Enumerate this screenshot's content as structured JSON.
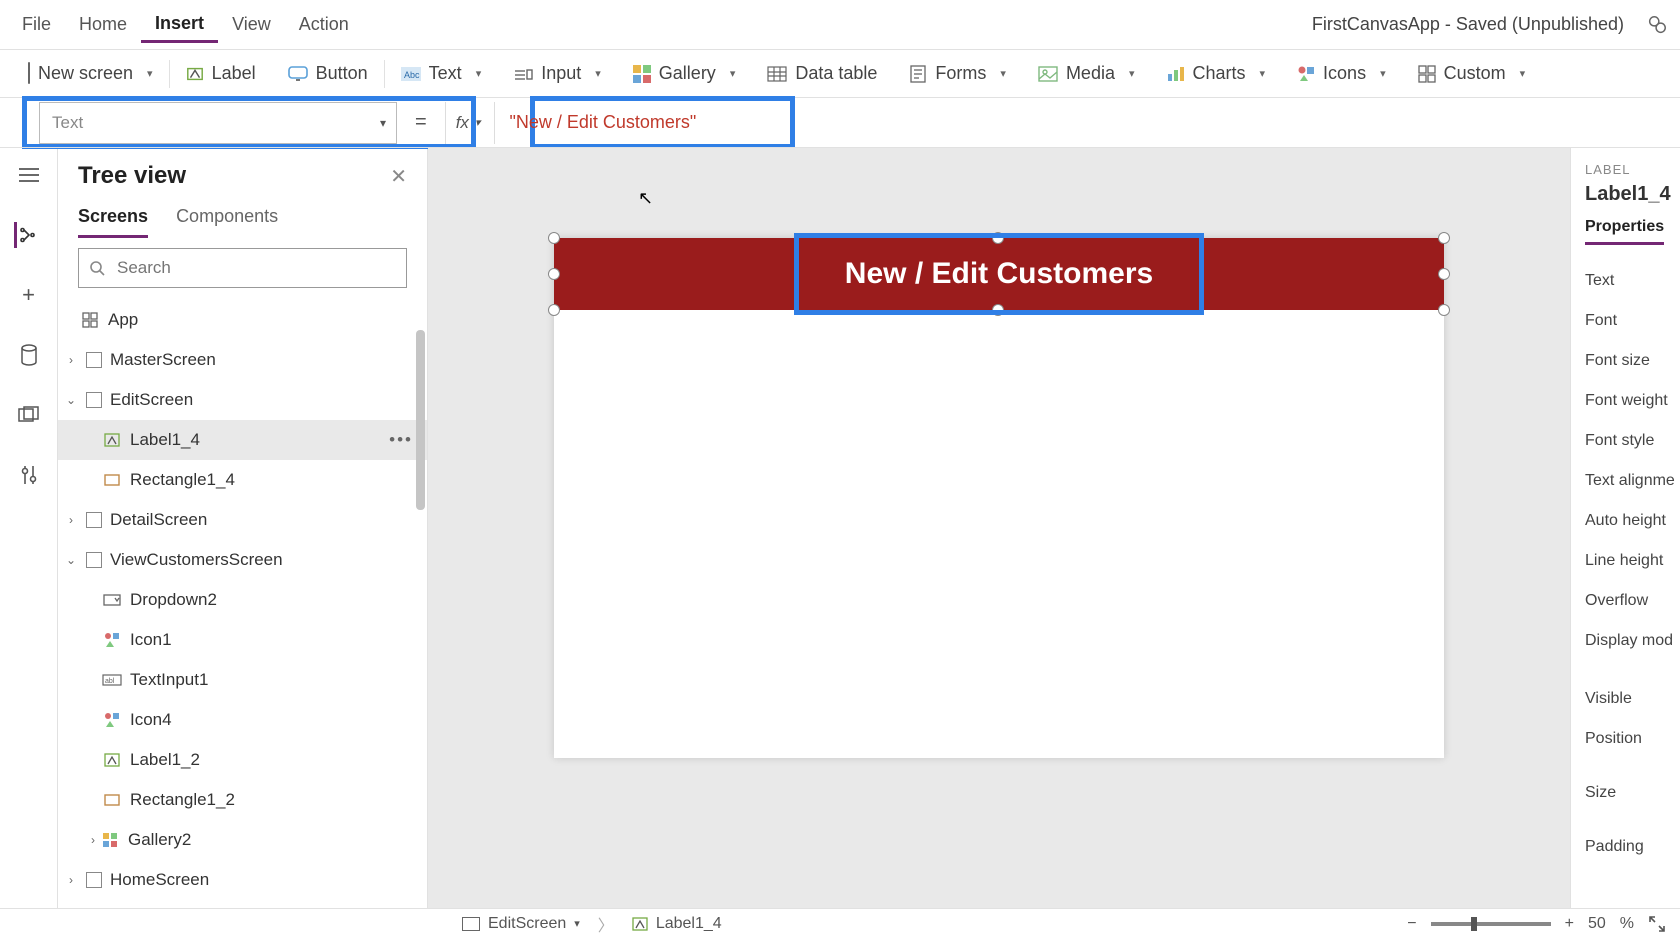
{
  "menu": {
    "file": "File",
    "home": "Home",
    "insert": "Insert",
    "view": "View",
    "action": "Action"
  },
  "saveInfo": "FirstCanvasApp - Saved (Unpublished)",
  "ribbon": {
    "newScreen": "New screen",
    "label": "Label",
    "button": "Button",
    "text": "Text",
    "input": "Input",
    "gallery": "Gallery",
    "dataTable": "Data table",
    "forms": "Forms",
    "media": "Media",
    "charts": "Charts",
    "icons": "Icons",
    "custom": "Custom"
  },
  "formula": {
    "property": "Text",
    "fx": "fx",
    "eq": "=",
    "value": "\"New / Edit Customers\""
  },
  "tree": {
    "title": "Tree view",
    "tabs": {
      "screens": "Screens",
      "components": "Components"
    },
    "searchPlaceholder": "Search",
    "app": "App",
    "nodes": {
      "master": "MasterScreen",
      "edit": "EditScreen",
      "label14": "Label1_4",
      "rect14": "Rectangle1_4",
      "detail": "DetailScreen",
      "viewCust": "ViewCustomersScreen",
      "dropdown2": "Dropdown2",
      "icon1": "Icon1",
      "textInput1": "TextInput1",
      "icon4": "Icon4",
      "label12": "Label1_2",
      "rect12": "Rectangle1_2",
      "gallery2": "Gallery2",
      "home": "HomeScreen"
    }
  },
  "canvas": {
    "headerText": "New / Edit Customers"
  },
  "props": {
    "typeLabel": "LABEL",
    "name": "Label1_4",
    "tab": "Properties",
    "rows": [
      "Text",
      "Font",
      "Font size",
      "Font weight",
      "Font style",
      "Text alignme",
      "Auto height",
      "Line height",
      "Overflow",
      "Display mod",
      "Visible",
      "Position",
      "Size",
      "Padding"
    ]
  },
  "status": {
    "screen": "EditScreen",
    "element": "Label1_4",
    "zoomMinus": "−",
    "zoomPlus": "+",
    "zoomVal": "50",
    "zoomPct": "%"
  }
}
